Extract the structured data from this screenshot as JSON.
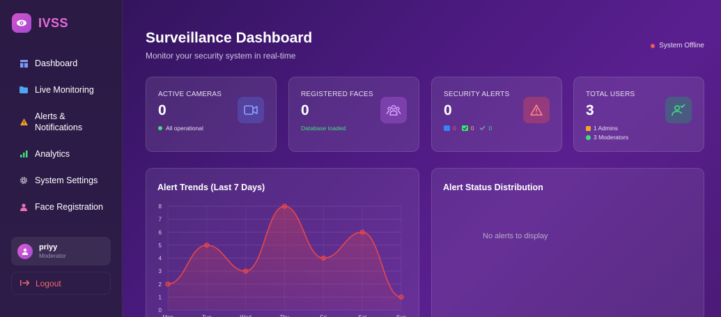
{
  "brand": {
    "name": "IVSS"
  },
  "sidebar": {
    "items": [
      {
        "label": "Dashboard",
        "icon": "dashboard-icon"
      },
      {
        "label": "Live Monitoring",
        "icon": "folder-icon"
      },
      {
        "label": "Alerts & Notifications",
        "icon": "warning-icon"
      },
      {
        "label": "Analytics",
        "icon": "bar-chart-icon"
      },
      {
        "label": "System Settings",
        "icon": "gear-icon"
      },
      {
        "label": "Face Registration",
        "icon": "person-icon"
      }
    ],
    "user": {
      "name": "priyy",
      "role": "Moderator"
    },
    "logout_label": "Logout"
  },
  "header": {
    "title": "Surveillance Dashboard",
    "subtitle": "Monitor your security system in real-time",
    "status": "System Offline"
  },
  "cards": {
    "cameras": {
      "label": "ACTIVE CAMERAS",
      "value": "0",
      "foot": "All operational"
    },
    "faces": {
      "label": "REGISTERED FACES",
      "value": "0",
      "foot": "Database loaded"
    },
    "alerts": {
      "label": "SECURITY ALERTS",
      "value": "0",
      "new": "0",
      "ack": "0",
      "resolved": "0"
    },
    "users": {
      "label": "TOTAL USERS",
      "value": "3",
      "admins": "1 Admins",
      "moderators": "3 Moderators"
    }
  },
  "colors": {
    "accent": "#e86bd9",
    "success": "#3ee07a",
    "danger": "#f05a5a",
    "line": "#e8474a"
  },
  "trend_panel": {
    "title": "Alert Trends (Last 7 Days)"
  },
  "distribution_panel": {
    "title": "Alert Status Distribution",
    "empty": "No alerts to display"
  },
  "chart_data": {
    "type": "line",
    "x": [
      "Mon",
      "Tue",
      "Wed",
      "Thu",
      "Fri",
      "Sat",
      "Sun"
    ],
    "series": [
      {
        "values": [
          2,
          5,
          3,
          8,
          4,
          6,
          1
        ]
      }
    ],
    "ylim": [
      0,
      8
    ],
    "yticks": [
      0,
      1,
      2,
      3,
      4,
      5,
      6,
      7,
      8
    ],
    "grid": true,
    "smooth": true,
    "area": true
  }
}
